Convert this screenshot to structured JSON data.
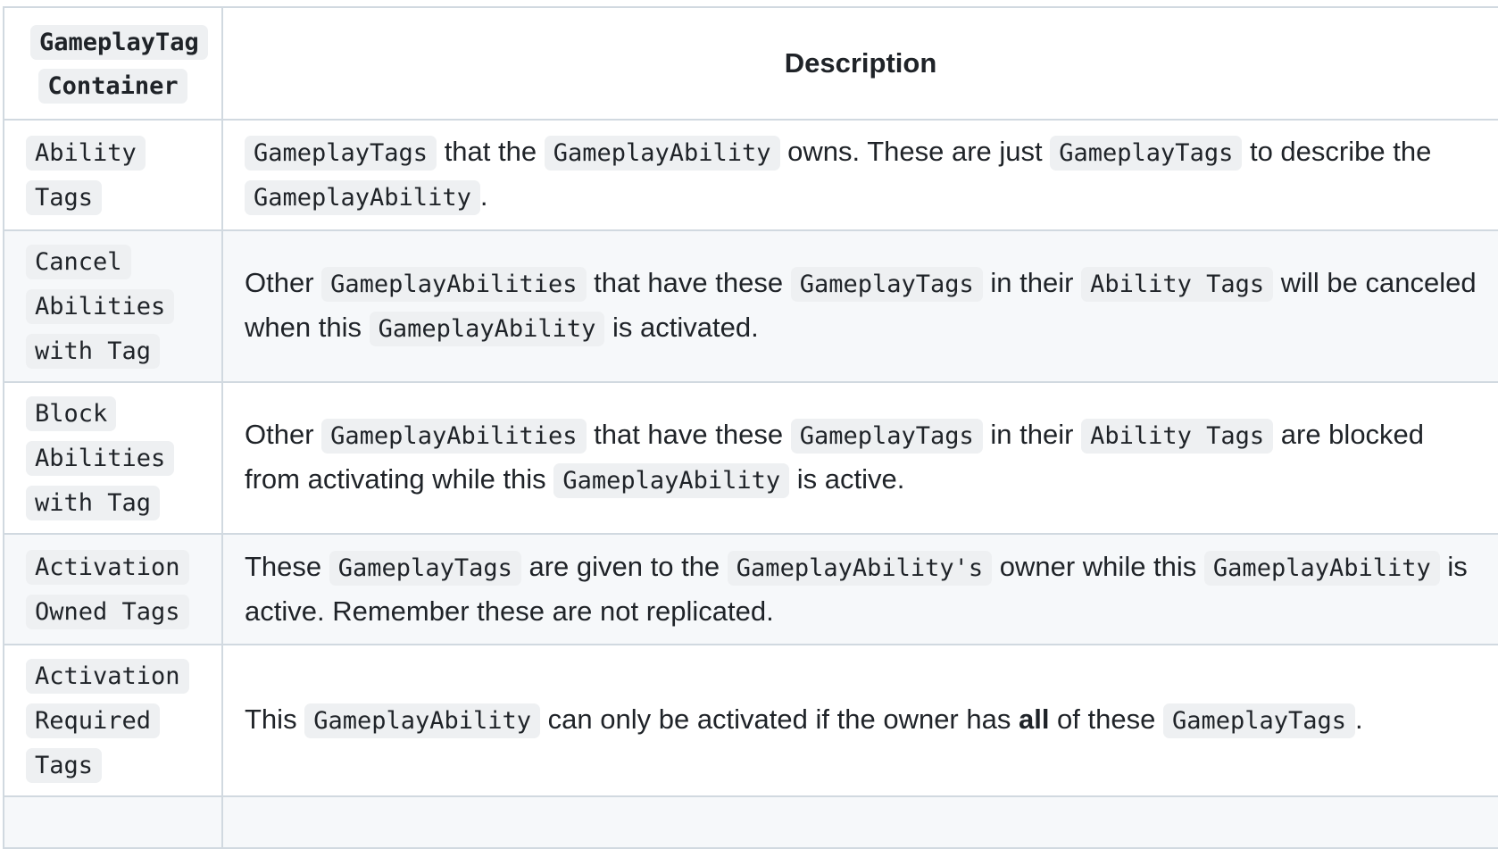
{
  "header": {
    "col1": "GameplayTag Container",
    "col2": "Description"
  },
  "rows": [
    {
      "tag": "Ability Tags",
      "parts": [
        {
          "code": "GameplayTags"
        },
        {
          "text": " that the "
        },
        {
          "code": "GameplayAbility"
        },
        {
          "text": " owns. These are just "
        },
        {
          "code": "GameplayTags"
        },
        {
          "text": " to describe the "
        },
        {
          "code": "GameplayAbility"
        },
        {
          "text": "."
        }
      ]
    },
    {
      "tag": "Cancel Abilities with Tag",
      "parts": [
        {
          "text": "Other "
        },
        {
          "code": "GameplayAbilities"
        },
        {
          "text": " that have these "
        },
        {
          "code": "GameplayTags"
        },
        {
          "text": " in their "
        },
        {
          "code": "Ability Tags"
        },
        {
          "text": " will be canceled when this "
        },
        {
          "code": "GameplayAbility"
        },
        {
          "text": " is activated."
        }
      ]
    },
    {
      "tag": "Block Abilities with Tag",
      "parts": [
        {
          "text": "Other "
        },
        {
          "code": "GameplayAbilities"
        },
        {
          "text": " that have these "
        },
        {
          "code": "GameplayTags"
        },
        {
          "text": " in their "
        },
        {
          "code": "Ability Tags"
        },
        {
          "text": " are blocked from activating while this "
        },
        {
          "code": "GameplayAbility"
        },
        {
          "text": " is active."
        }
      ]
    },
    {
      "tag": "Activation Owned Tags",
      "parts": [
        {
          "text": "These "
        },
        {
          "code": "GameplayTags"
        },
        {
          "text": " are given to the "
        },
        {
          "code": "GameplayAbility's"
        },
        {
          "text": " owner while this "
        },
        {
          "code": "GameplayAbility"
        },
        {
          "text": " is active. Remember these are not replicated."
        }
      ]
    },
    {
      "tag": "Activation Required Tags",
      "parts": [
        {
          "text": "This "
        },
        {
          "code": "GameplayAbility"
        },
        {
          "text": " can only be activated if the owner has "
        },
        {
          "bold": "all"
        },
        {
          "text": " of these "
        },
        {
          "code": "GameplayTags"
        },
        {
          "text": "."
        }
      ]
    }
  ]
}
